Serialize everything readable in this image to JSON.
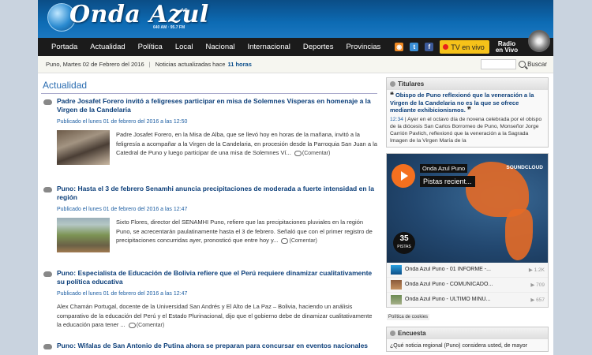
{
  "header": {
    "logo_text": "Onda Azul",
    "logo_mark": "AC",
    "logo_sub": "640 AM  ·  95.7 FM"
  },
  "nav": {
    "items": [
      "Portada",
      "Actualidad",
      "Política",
      "Local",
      "Nacional",
      "Internacional",
      "Deportes",
      "Provincias"
    ],
    "tv_label": "TV en vivo",
    "radio_line1": "Radio",
    "radio_line2": "en Vivo"
  },
  "datebar": {
    "date": "Puno, Martes 02 de Febrero del 2016",
    "separator": "|",
    "updated_prefix": "Noticias actualizadas hace",
    "updated_hours": "11 horas",
    "search_button": "Buscar"
  },
  "main": {
    "section_title": "Actualidad",
    "articles": [
      {
        "title": "Padre Josafet Forero invitó a feligreses participar en misa de Solemnes Vísperas en homenaje a la Virgen de la Candelaria",
        "date": "Publicado el lunes 01 de febrero del 2016 a las 12:50",
        "text": "Padre Josafet Forero, en la Misa de Alba, que se llevó hoy en horas de la mañana, invitó a la feligresía a acompañar a la Virgen de la Candelaria, en procesión desde la Parroquia San Juan a la Catedral de Puno y luego participar de una misa de Solemnes Ví...",
        "comment": "(Comentar)"
      },
      {
        "title": "Puno: Hasta el 3 de febrero Senamhi anuncia precipitaciones de moderada a fuerte intensidad en la región",
        "date": "Publicado el lunes 01 de febrero del 2016 a las 12:47",
        "text": "Sixto Flores, director del SENAMHI Puno, refiere que las precipitaciones pluviales en la región Puno, se acrecentarán paulatinamente hasta el 3 de febrero. Señaló que con el primer registro de precipitaciones concurridas ayer, pronosticó que entre hoy y...",
        "comment": "(Comentar)"
      },
      {
        "title": "Puno: Especialista de Educación de Bolivia refiere que el Perú requiere dinamizar cualitativamente su política educativa",
        "date": "Publicado el lunes 01 de febrero del 2016 a las 12:47",
        "text": "Alex Chamán Portugal, docente de la Universidad San Andrés y El Alto de La Paz – Bolivia, haciendo un análisis comparativo de la educación del Perú y el Estado Plurinacional, dijo que el gobierno debe de dinamizar cualitativamente la educación para tener ...",
        "comment": "(Comentar)"
      },
      {
        "title": "Puno: Wifalas de San Antonio de Putina ahora se preparan para concursar en eventos nacionales"
      }
    ]
  },
  "sidebar": {
    "titulares_header": "Titulares",
    "headline": "Obispo de Puno reflexionó que la veneración a la Virgen de la Candelaria no es la que se ofrece mediante exhibicionismos.",
    "headline_time": "12:34",
    "headline_text": "| Ayer en el octavo día de novena celebrada por el obispo de la diócesis San Carlos Borromeo de Puno, Monseñor Jorge Carrión Pavlich, reflexionó que la veneración a la Sagrada Imagen de la Virgen María de la",
    "soundcloud": {
      "user": "Onda Azul Puno",
      "set": "Pistas recient...",
      "brand": "SOUNDCLOUD",
      "count": "35",
      "count_label": "PISTAS",
      "tracks": [
        {
          "title": "Onda Azul Puno - 01 INFORME -...",
          "plays": "1.2K"
        },
        {
          "title": "Onda Azul Puno - COMUNICADO...",
          "plays": "709"
        },
        {
          "title": "Onda Azul Puno - ÚLTIMO MINU...",
          "plays": "657"
        }
      ]
    },
    "cookies": "Política de cookies",
    "encuesta_header": "Encuesta",
    "encuesta_question": "¿Qué noticia regional (Puno) considera usted, de mayor"
  }
}
